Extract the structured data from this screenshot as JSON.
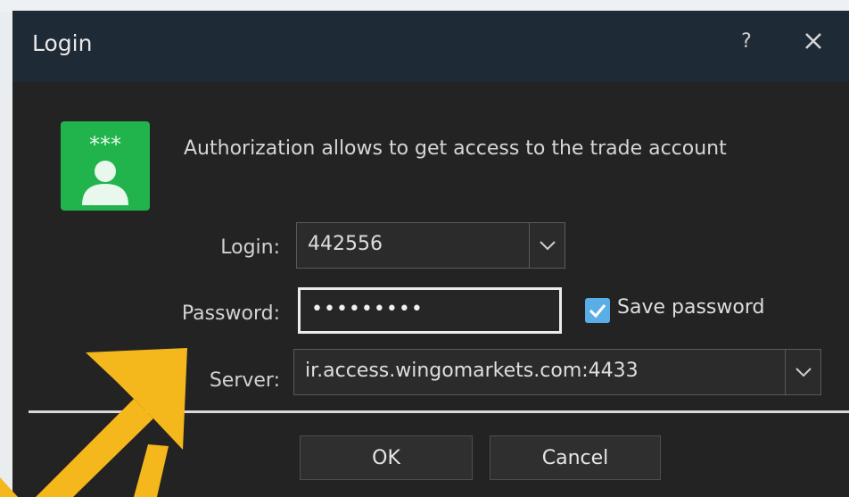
{
  "dialog": {
    "title": "Login",
    "help_label": "?",
    "close_icon": "close-icon"
  },
  "header": {
    "icon": "user-password-icon",
    "description": "Authorization allows to get access to the trade account"
  },
  "form": {
    "login_label": "Login:",
    "login_value": "442556",
    "password_label": "Password:",
    "password_value": "•••••••••",
    "save_password_label": "Save password",
    "save_password_checked": true,
    "server_label": "Server:",
    "server_value": "ir.access.wingomarkets.com:4433"
  },
  "buttons": {
    "ok_label": "OK",
    "cancel_label": "Cancel"
  },
  "colors": {
    "title_bar": "#1e2a36",
    "body": "#232323",
    "icon_green": "#21b34c",
    "checkbox_blue": "#5aaee6",
    "annotation_arrow": "#f5b81c"
  }
}
